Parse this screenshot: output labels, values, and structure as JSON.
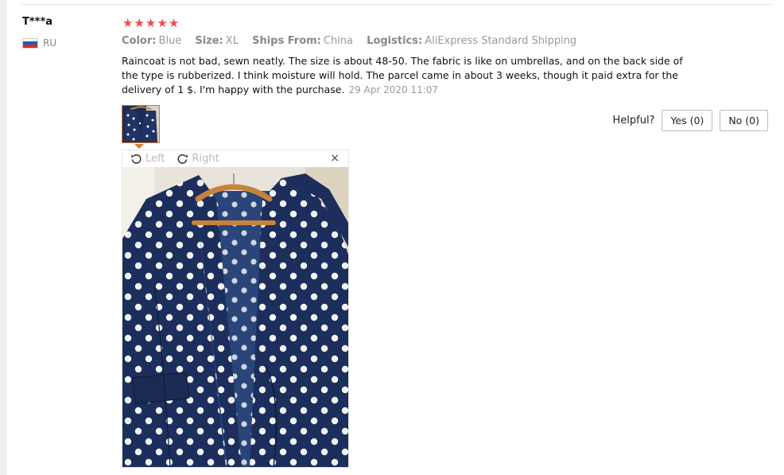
{
  "reviewer": {
    "name": "T***a",
    "country_code": "RU",
    "flag_colors": [
      "#ffffff",
      "#1a5bc4",
      "#d52b1e"
    ]
  },
  "rating": {
    "stars": 5,
    "max": 5,
    "star_glyph": "★",
    "color": "#f5484a"
  },
  "attributes": [
    {
      "key": "Color:",
      "value": "Blue"
    },
    {
      "key": "Size:",
      "value": "XL"
    },
    {
      "key": "Ships From:",
      "value": "China"
    },
    {
      "key": "Logistics:",
      "value": "AliExpress Standard Shipping"
    }
  ],
  "review": {
    "text": "Raincoat is not bad, sewn neatly. The size is about 48-50. The fabric is like on umbrellas, and on the back side of the type is rubberized. I think moisture will hold. The parcel came in about 3 weeks, though it paid extra for the delivery of 1 $. I'm happy with the purchase.",
    "date": "29 Apr 2020 11:07"
  },
  "helpful": {
    "label": "Helpful?",
    "yes_label": "Yes (0)",
    "no_label": "No (0)"
  },
  "viewer": {
    "rotate_left_label": "Left",
    "rotate_right_label": "Right",
    "close_glyph": "×",
    "photo_icon": "navy-polka-dot-raincoat-photo"
  },
  "colors": {
    "accent": "#e0781e",
    "coat_navy": "#1b2d57",
    "hanger_wood": "#c7833c"
  }
}
